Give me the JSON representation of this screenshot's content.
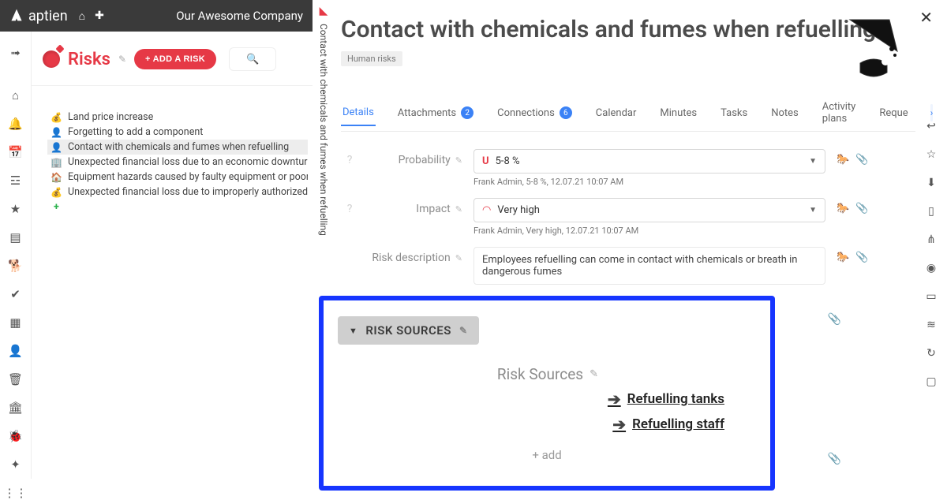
{
  "topbar": {
    "brand": "aptien",
    "company": "Our Awesome Company"
  },
  "sidebar": {
    "title": "Risks",
    "add_label": "+ ADD A RISK",
    "items": [
      {
        "icon": "💰",
        "label": "Land price increase"
      },
      {
        "icon": "👤",
        "label": "Forgetting to add a component"
      },
      {
        "icon": "👤",
        "label": "Contact with chemicals and fumes when refuelling",
        "selected": true
      },
      {
        "icon": "🏢",
        "label": "Unexpected financial loss due to an economic downturn, or bankruptcy"
      },
      {
        "icon": "🏠",
        "label": "Equipment hazards caused by faulty equipment or poor processes"
      },
      {
        "icon": "💰",
        "label": "Unexpected financial loss due to improperly authorized payments"
      }
    ]
  },
  "vtab": {
    "title": "Contact with chemicals and fumes when refuelling"
  },
  "page": {
    "title": "Contact with chemicals and fumes when refuelling",
    "tag": "Human risks"
  },
  "tabs": {
    "items": [
      {
        "label": "Details",
        "active": true
      },
      {
        "label": "Attachments",
        "badge": "2"
      },
      {
        "label": "Connections",
        "badge": "6"
      },
      {
        "label": "Calendar"
      },
      {
        "label": "Minutes"
      },
      {
        "label": "Tasks"
      },
      {
        "label": "Notes"
      },
      {
        "label": "Activity plans"
      },
      {
        "label": "Reque"
      }
    ]
  },
  "fields": {
    "probability": {
      "label": "Probability",
      "value": "5-8 %",
      "meta": "Frank Admin, 5-8 %, 12.07.21 10:07 AM"
    },
    "impact": {
      "label": "Impact",
      "value": "Very high",
      "meta": "Frank Admin, Very high, 12.07.21 10:07 AM"
    },
    "description": {
      "label": "Risk description",
      "value": "Employees refuelling can come in contact with chemicals or breath in dangerous fumes"
    }
  },
  "risk_sources": {
    "header": "RISK SOURCES",
    "label": "Risk Sources",
    "links": [
      "Refuelling tanks",
      "Refuelling staff"
    ],
    "add": "+ add"
  }
}
